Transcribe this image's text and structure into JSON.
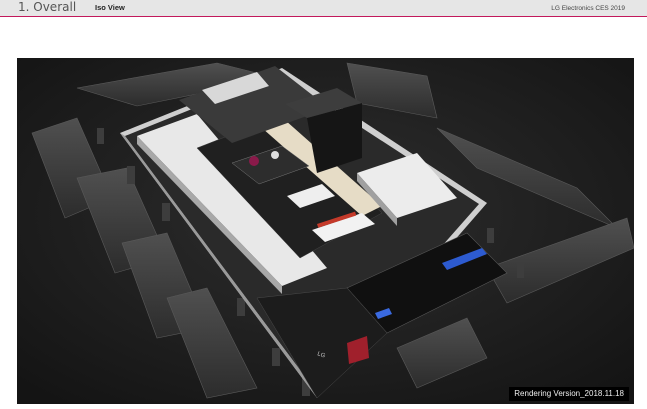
{
  "header": {
    "section_title": "1. Overall",
    "subtitle": "Iso View",
    "brand": "LG Electronics CES 2019"
  },
  "render": {
    "caption": "Rendering Version_2018.11.18"
  },
  "colors": {
    "header_bg": "#e6e6e6",
    "accent_rule": "#c2185b",
    "render_bg": "#1a1a1a"
  }
}
